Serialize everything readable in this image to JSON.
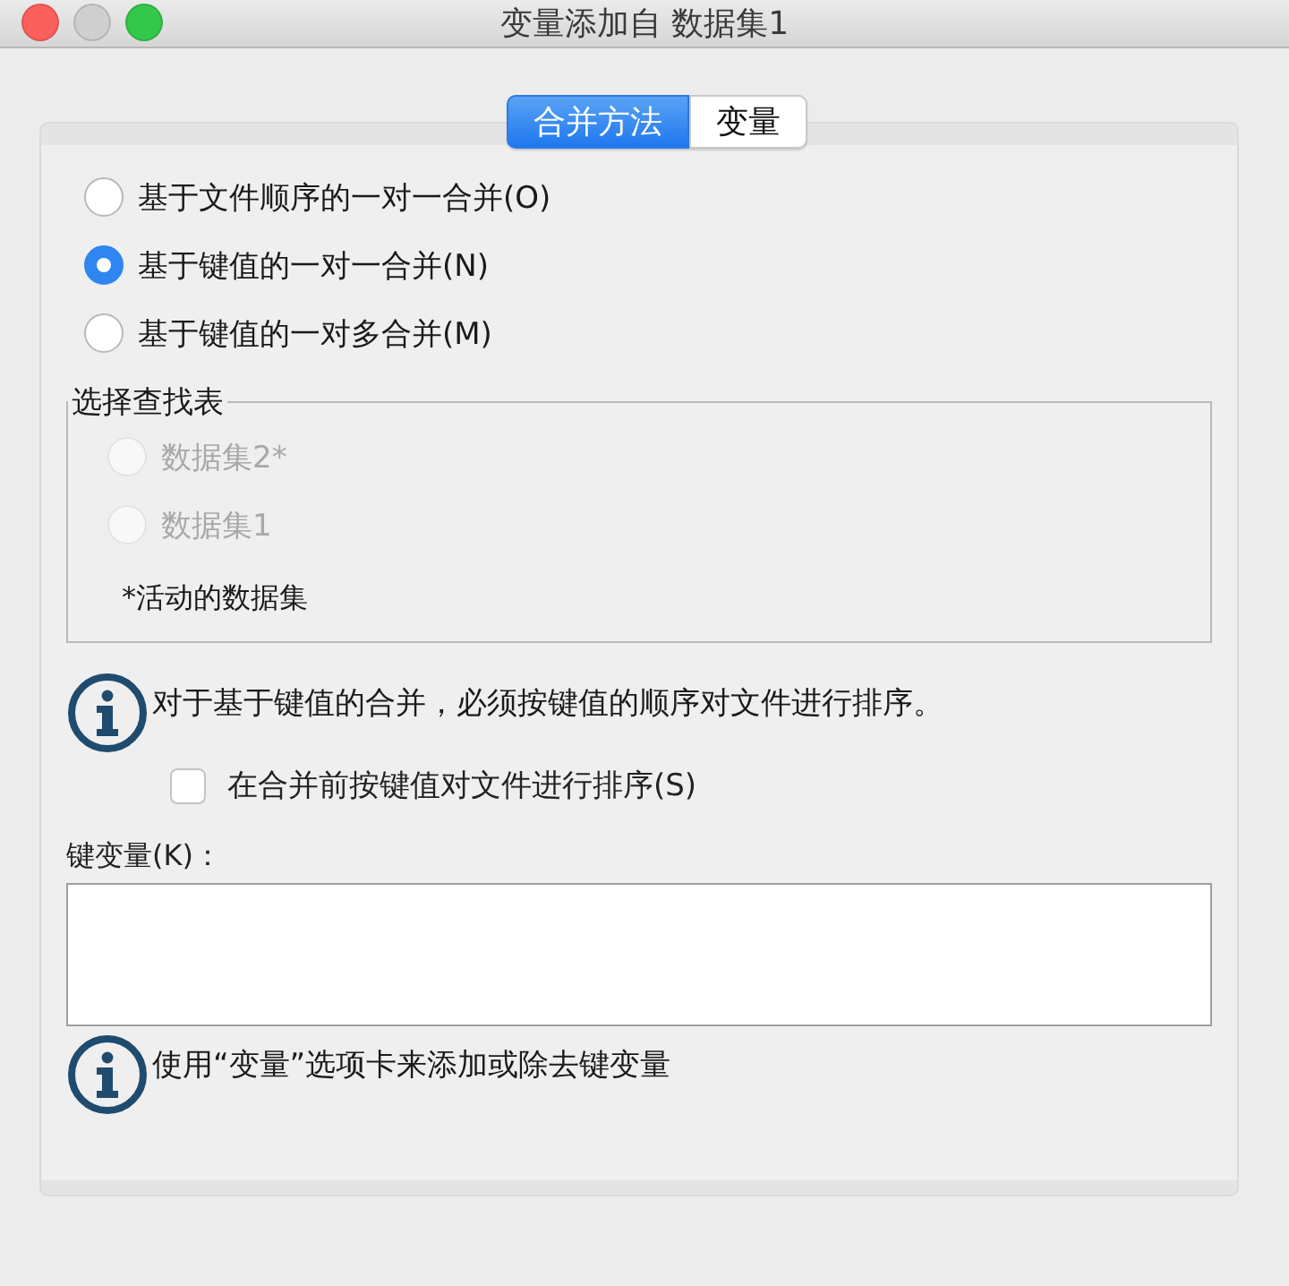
{
  "window": {
    "title": "变量添加自 数据集1"
  },
  "tabs": [
    {
      "label": "合并方法",
      "selected": true
    },
    {
      "label": "变量",
      "selected": false
    }
  ],
  "merge_methods": [
    {
      "label": "基于文件顺序的一对一合并(O)",
      "selected": false
    },
    {
      "label": "基于键值的一对一合并(N)",
      "selected": true
    },
    {
      "label": "基于键值的一对多合并(M)",
      "selected": false
    }
  ],
  "lookup_table": {
    "title": "选择查找表",
    "options": [
      {
        "label": "数据集2*",
        "selected": false,
        "disabled": true
      },
      {
        "label": "数据集1",
        "selected": false,
        "disabled": true
      }
    ],
    "footnote": "*活动的数据集"
  },
  "sort_notice": "对于基于键值的合并，必须按键值的顺序对文件进行排序。",
  "sort_checkbox": {
    "label": "在合并前按键值对文件进行排序(S)",
    "checked": false
  },
  "key_variables": {
    "label": "键变量(K)："
  },
  "key_hint": "使用“变量”选项卡来添加或除去键变量"
}
